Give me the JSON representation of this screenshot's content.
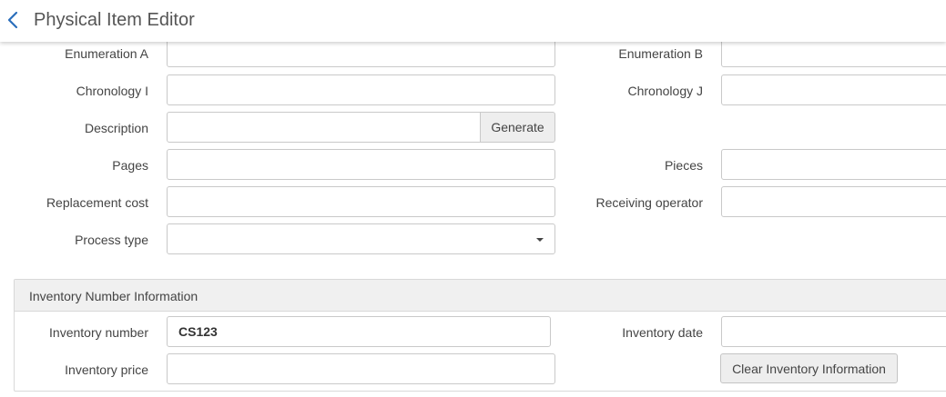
{
  "header": {
    "title": "Physical Item Editor",
    "back_icon": "chevron-left-icon",
    "accent_color": "#2a6ebb"
  },
  "form": {
    "enumeration_a": {
      "label": "Enumeration A",
      "value": ""
    },
    "enumeration_b": {
      "label": "Enumeration B",
      "value": ""
    },
    "chronology_i": {
      "label": "Chronology I",
      "value": ""
    },
    "chronology_j": {
      "label": "Chronology J",
      "value": ""
    },
    "description": {
      "label": "Description",
      "value": "",
      "generate_label": "Generate"
    },
    "pages": {
      "label": "Pages",
      "value": ""
    },
    "pieces": {
      "label": "Pieces",
      "value": ""
    },
    "replacement_cost": {
      "label": "Replacement cost",
      "value": ""
    },
    "receiving_operator": {
      "label": "Receiving operator",
      "value": ""
    },
    "process_type": {
      "label": "Process type",
      "value": ""
    }
  },
  "inventory": {
    "section_title": "Inventory Number Information",
    "inventory_number": {
      "label": "Inventory number",
      "value": "CS123"
    },
    "inventory_date": {
      "label": "Inventory date",
      "value": ""
    },
    "inventory_price": {
      "label": "Inventory price",
      "value": ""
    },
    "clear_label": "Clear Inventory Information"
  }
}
